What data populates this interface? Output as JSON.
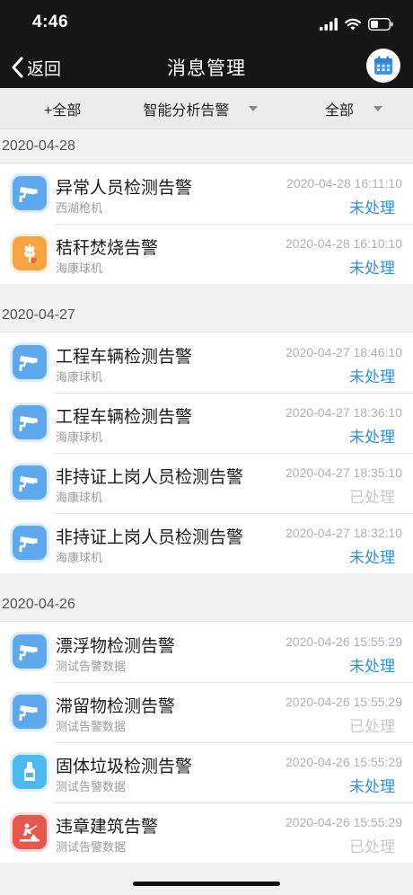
{
  "status_bar": {
    "time": "4:46"
  },
  "nav": {
    "back_label": "返回",
    "title": "消息管理"
  },
  "filters": [
    {
      "label": "+全部"
    },
    {
      "label": "智能分析告警"
    },
    {
      "label": "全部"
    }
  ],
  "groups": [
    {
      "date": "2020-04-28",
      "items": [
        {
          "icon": "camera-icon",
          "color": "blue",
          "title": "异常人员检测告警",
          "source": "西湖枪机",
          "time": "2020-04-28 16:11:10",
          "status": "未处理",
          "state": "pending"
        },
        {
          "icon": "wheat-fire-icon",
          "color": "orange",
          "title": "秸秆焚烧告警",
          "source": "海康球机",
          "time": "2020-04-28 16:10:10",
          "status": "未处理",
          "state": "pending"
        }
      ]
    },
    {
      "date": "2020-04-27",
      "items": [
        {
          "icon": "camera-icon",
          "color": "blue",
          "title": "工程车辆检测告警",
          "source": "海康球机",
          "time": "2020-04-27 18:46:10",
          "status": "未处理",
          "state": "pending"
        },
        {
          "icon": "camera-icon",
          "color": "blue",
          "title": "工程车辆检测告警",
          "source": "海康球机",
          "time": "2020-04-27 18:36:10",
          "status": "未处理",
          "state": "pending"
        },
        {
          "icon": "camera-icon",
          "color": "blue",
          "title": "非持证上岗人员检测告警",
          "source": "海康球机",
          "time": "2020-04-27 18:35:10",
          "status": "已处理",
          "state": "done"
        },
        {
          "icon": "camera-icon",
          "color": "blue",
          "title": "非持证上岗人员检测告警",
          "source": "海康球机",
          "time": "2020-04-27 18:32:10",
          "status": "未处理",
          "state": "pending"
        }
      ]
    },
    {
      "date": "2020-04-26",
      "items": [
        {
          "icon": "camera-icon",
          "color": "blue",
          "title": "漂浮物检测告警",
          "source": "测试告警数据",
          "time": "2020-04-26 15:55:29",
          "status": "未处理",
          "state": "pending"
        },
        {
          "icon": "camera-icon",
          "color": "blue",
          "title": "滞留物检测告警",
          "source": "测试告警数据",
          "time": "2020-04-26 15:55:29",
          "status": "已处理",
          "state": "done"
        },
        {
          "icon": "bottle-icon",
          "color": "cyan",
          "title": "固体垃圾检测告警",
          "source": "测试告警数据",
          "time": "2020-04-26 15:55:29",
          "status": "未处理",
          "state": "pending"
        },
        {
          "icon": "construction-icon",
          "color": "red",
          "title": "违章建筑告警",
          "source": "测试告警数据",
          "time": "2020-04-26 15:55:29",
          "status": "已处理",
          "state": "done"
        }
      ]
    }
  ]
}
